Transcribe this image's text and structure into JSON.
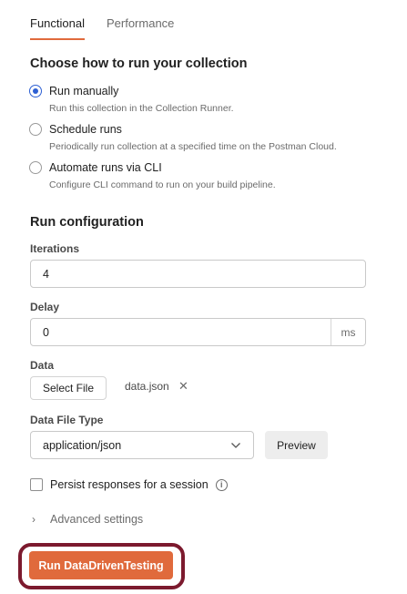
{
  "tabs": [
    {
      "label": "Functional",
      "active": true
    },
    {
      "label": "Performance",
      "active": false
    }
  ],
  "run_mode": {
    "title": "Choose how to run your collection",
    "options": [
      {
        "label": "Run manually",
        "description": "Run this collection in the Collection Runner.",
        "checked": true
      },
      {
        "label": "Schedule runs",
        "description": "Periodically run collection at a specified time on the Postman Cloud.",
        "checked": false
      },
      {
        "label": "Automate runs via CLI",
        "description": "Configure CLI command to run on your build pipeline.",
        "checked": false
      }
    ]
  },
  "config": {
    "title": "Run configuration",
    "iterations": {
      "label": "Iterations",
      "value": "4"
    },
    "delay": {
      "label": "Delay",
      "value": "0",
      "unit": "ms"
    },
    "data": {
      "label": "Data",
      "select_button": "Select File",
      "file_name": "data.json",
      "remove_glyph": "✕"
    },
    "data_file_type": {
      "label": "Data File Type",
      "value": "application/json",
      "preview_button": "Preview"
    },
    "persist": {
      "label": "Persist responses for a session",
      "checked": false,
      "info_glyph": "i"
    },
    "advanced": {
      "label": "Advanced settings",
      "chevron_glyph": "›"
    }
  },
  "run_button": {
    "label": "Run DataDrivenTesting"
  },
  "colors": {
    "accent": "#e06a3c",
    "radio_selected": "#2d5fd3",
    "highlight_ring": "#7c1a2e"
  }
}
